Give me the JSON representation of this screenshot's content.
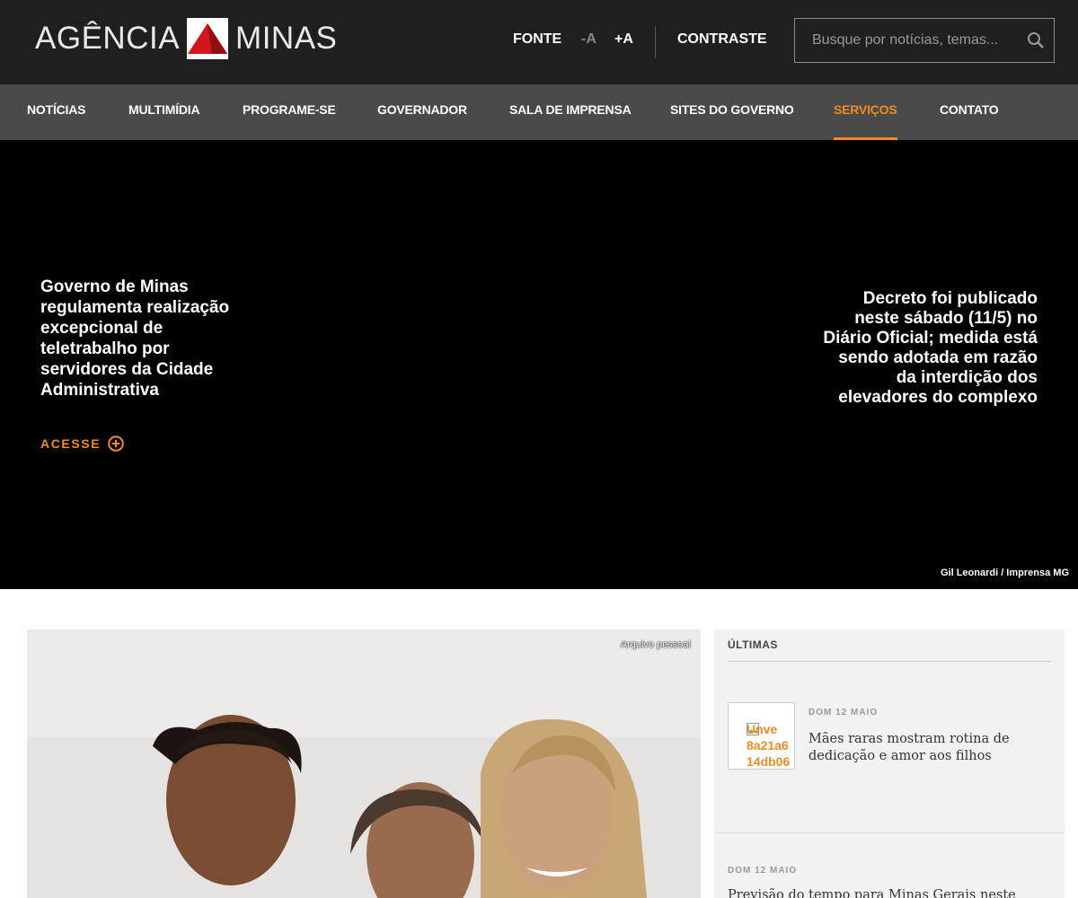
{
  "header": {
    "logo_left": "AGÊNCIA",
    "logo_right": "MINAS",
    "font_label": "FONTE",
    "font_minus": "-A",
    "font_plus": "+A",
    "contrast_label": "CONTRASTE",
    "search_placeholder": "Busque por notícias, temas..."
  },
  "nav": {
    "items": [
      {
        "label": "NOTÍCIAS"
      },
      {
        "label": "MULTIMÍDIA"
      },
      {
        "label": "PROGRAME-SE"
      },
      {
        "label": "GOVERNADOR"
      },
      {
        "label": "SALA DE IMPRENSA"
      },
      {
        "label": "SITES DO GOVERNO"
      },
      {
        "label": "SERVIÇOS"
      },
      {
        "label": "CONTATO"
      }
    ],
    "active": "SERVIÇOS"
  },
  "hero": {
    "title": "Governo de Minas regulamenta realização excepcional de teletrabalho por servidores da Cidade Administrativa",
    "cta": "ACESSE",
    "description": "Decreto foi publicado neste sábado (11/5) no Diário Oficial; medida está sendo adotada em razão da interdição dos elevadores do complexo",
    "credit": "Gil Leonardi / Imprensa MG"
  },
  "feature": {
    "credit": "Arquivo pessoal"
  },
  "sidebar": {
    "title": "ÚLTIMAS",
    "items": [
      {
        "date": "DOM 12 MAIO",
        "title": "Mães raras mostram rotina de dedicação e amor aos filhos",
        "thumb_alt": "Unve\n8a21a6\n14db06"
      },
      {
        "date": "DOM 12 MAIO",
        "title": "Previsão do tempo para Minas Gerais neste"
      }
    ]
  },
  "colors": {
    "accent": "#f08a22",
    "header_bg": "#1f1f1f",
    "nav_bg": "#4a4a4a",
    "logo_red": "#d4161b"
  }
}
